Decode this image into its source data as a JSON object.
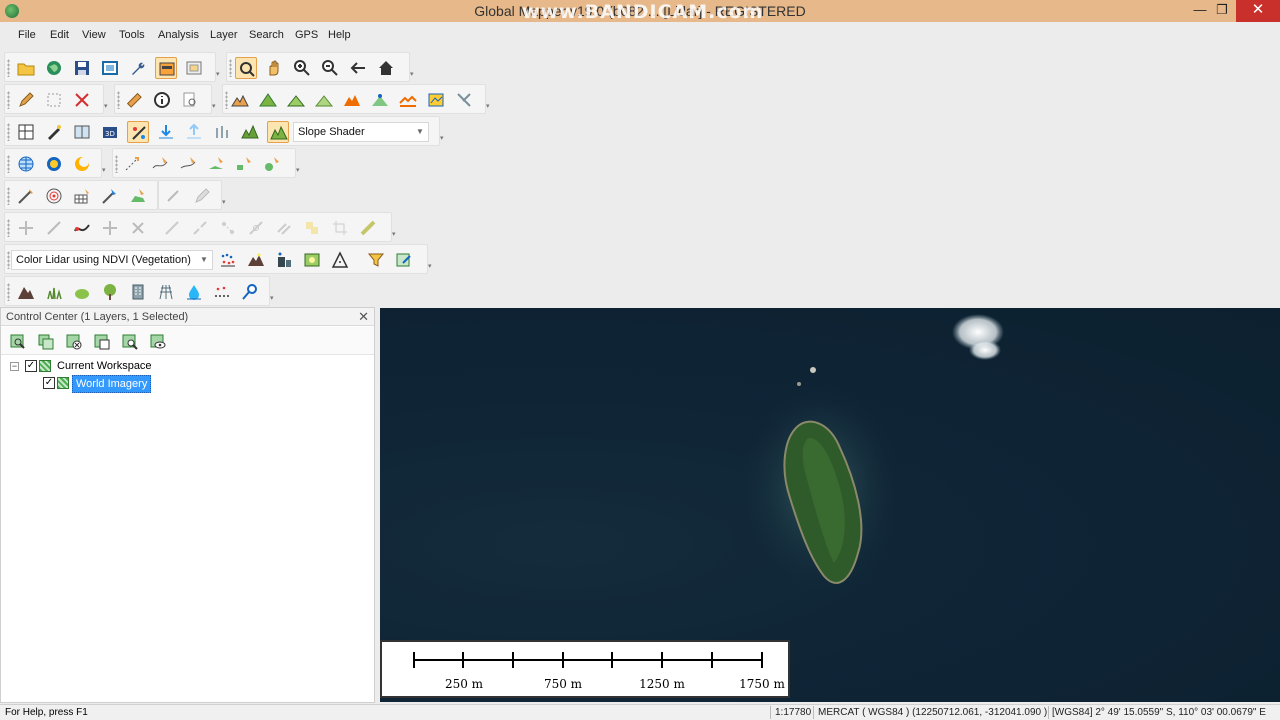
{
  "window": {
    "title": "Global Mapper v19.0 (b082 ... [Lidar] - REGISTERED",
    "watermark": "www.BANDICAM.com",
    "minimize": "—",
    "maximize": "❐",
    "close": "✕"
  },
  "menu": [
    "File",
    "Edit",
    "View",
    "Tools",
    "Analysis",
    "Layer",
    "Search",
    "GPS",
    "Help"
  ],
  "toolbars": {
    "shader_combo": "Slope Shader",
    "lidar_combo": "Color Lidar using NDVI (Vegetation)"
  },
  "control_center": {
    "title": "Control Center",
    "subtitle": "(1 Layers, 1 Selected)",
    "close": "✕",
    "tree": {
      "workspace": "Current Workspace",
      "layer": "World Imagery"
    }
  },
  "scale_bar": {
    "labels": [
      "250 m",
      "750 m",
      "1250 m",
      "1750 m"
    ]
  },
  "status": {
    "help": "For Help, press F1",
    "scale": "1:17780",
    "projection": "MERCAT ( WGS84 ) (12250712.061, -312041.090 )",
    "latlon": "[WGS84] 2° 49' 15.0559\" S, 110° 03' 00.0679\" E"
  },
  "colors": {
    "titlebar": "#e6b88a",
    "selection": "#3399ff",
    "water": "#0f2434",
    "island": "#2f5a2a"
  }
}
